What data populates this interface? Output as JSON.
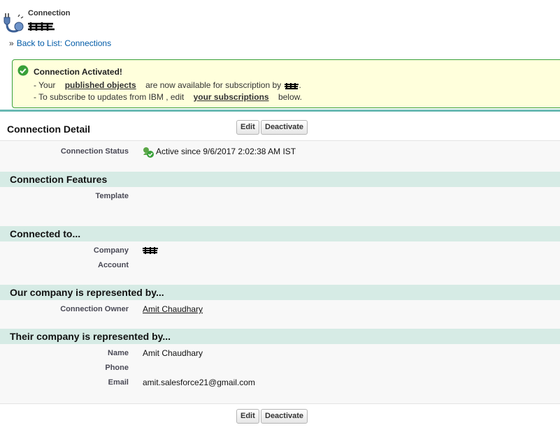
{
  "header": {
    "object_type": "Connection",
    "back_prefix": "»",
    "back_link": "Back to List: Connections"
  },
  "message": {
    "title": "Connection Activated!",
    "line1_pre": "- Your",
    "line1_link": "published objects",
    "line1_post": "are now available for subscription by",
    "line1_end": ".",
    "line2_pre": "- To subscribe to updates from IBM , edit",
    "line2_link": "your subscriptions",
    "line2_post": "below."
  },
  "detail": {
    "title": "Connection Detail",
    "edit_label": "Edit",
    "deactivate_label": "Deactivate",
    "status_label": "Connection Status",
    "status_value": "Active since 9/6/2017 2:02:38 AM IST",
    "sections": {
      "features": "Connection Features",
      "connected": "Connected to...",
      "ours": "Our company is represented by...",
      "theirs": "Their company is represented by..."
    },
    "template_label": "Template",
    "company_label": "Company",
    "account_label": "Account",
    "owner_label": "Connection Owner",
    "owner_value": "Amit Chaudhary",
    "name_label": "Name",
    "name_value": "Amit Chaudhary",
    "phone_label": "Phone",
    "email_label": "Email",
    "email_value": "amit.salesforce21@gmail.com"
  },
  "colors": {
    "link": "#015ba7",
    "section_bg": "#d6ebe5",
    "message_bg": "#ffffdc",
    "message_border": "#39a039",
    "panel_accent": "#69b9b3"
  }
}
